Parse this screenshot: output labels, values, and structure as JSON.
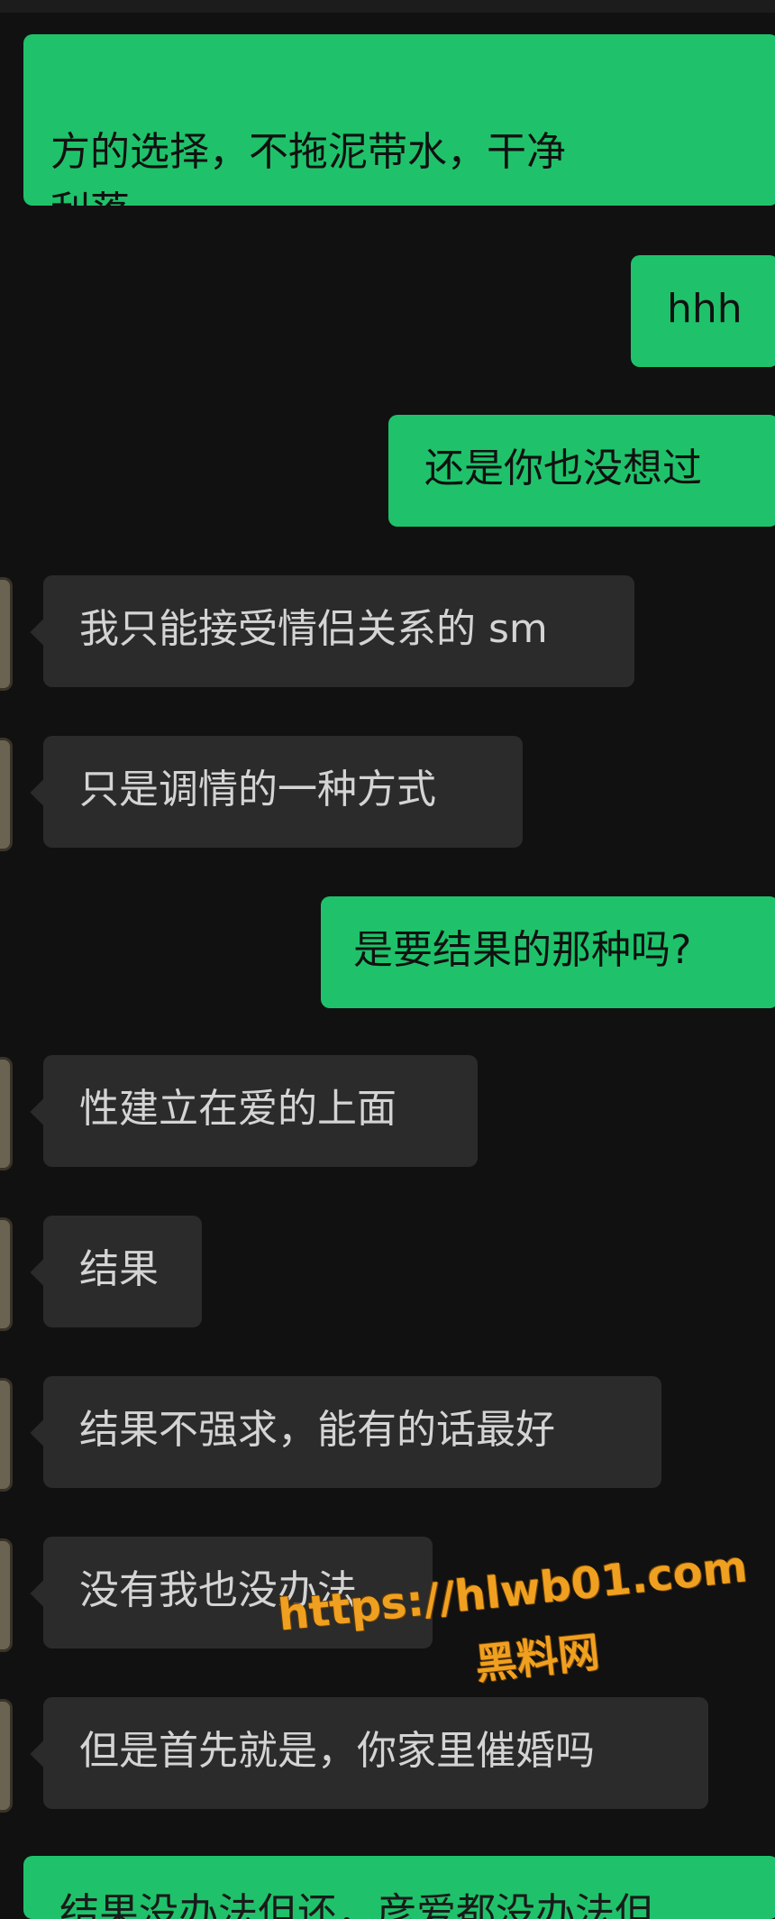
{
  "messages": [
    {
      "side": "right",
      "text": "方的选择，不拖泥带水，干净\n利落"
    },
    {
      "side": "right",
      "text": "hhh"
    },
    {
      "side": "right",
      "text": "还是你也没想过"
    },
    {
      "side": "left",
      "text": "我只能接受情侣关系的 sm"
    },
    {
      "side": "left",
      "text": "只是调情的一种方式"
    },
    {
      "side": "right",
      "text": "是要结果的那种吗?"
    },
    {
      "side": "left",
      "text": "性建立在爱的上面"
    },
    {
      "side": "left",
      "text": "结果"
    },
    {
      "side": "left",
      "text": "结果不强求，能有的话最好"
    },
    {
      "side": "left",
      "text": "没有我也没办法"
    },
    {
      "side": "left",
      "text": "但是首先就是，你家里催婚吗"
    },
    {
      "side": "right",
      "text": "结果没办法但还，彦爱都没办法但"
    }
  ],
  "watermark": {
    "url": "https://hlwb01.com",
    "site": "黑料网"
  },
  "colors": {
    "sent_bubble": "#1fc26a",
    "received_bubble": "#2b2b2b",
    "background": "#111111",
    "watermark": "#f0a020"
  }
}
